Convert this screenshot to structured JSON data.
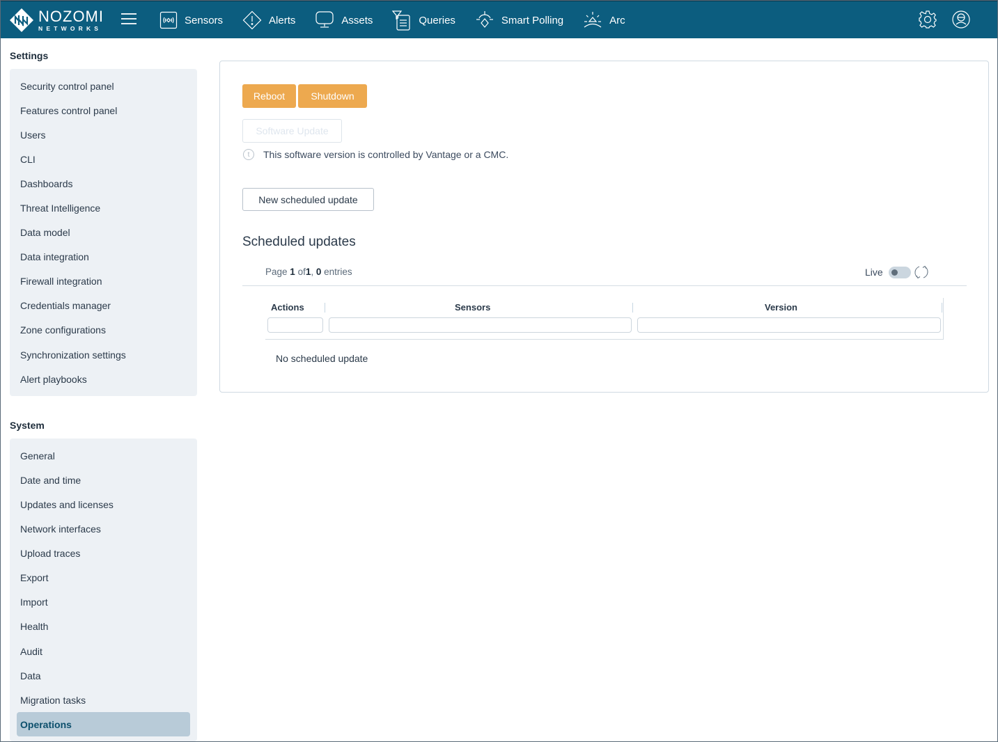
{
  "brand": {
    "name": "NOZOMI",
    "sub": "NETWORKS"
  },
  "nav": {
    "items": [
      {
        "label": "Sensors",
        "icon": "sensors-icon"
      },
      {
        "label": "Alerts",
        "icon": "alert-diamond-icon"
      },
      {
        "label": "Assets",
        "icon": "monitor-icon"
      },
      {
        "label": "Queries",
        "icon": "queries-filter-icon"
      },
      {
        "label": "Smart Polling",
        "icon": "smart-polling-icon"
      },
      {
        "label": "Arc",
        "icon": "arc-sun-icon"
      }
    ],
    "right_icons": [
      "gear-icon",
      "user-avatar-icon"
    ]
  },
  "sidebar": {
    "settings_title": "Settings",
    "settings_items": [
      "Security control panel",
      "Features control panel",
      "Users",
      "CLI",
      "Dashboards",
      "Threat Intelligence",
      "Data model",
      "Data integration",
      "Firewall integration",
      "Credentials manager",
      "Zone configurations",
      "Synchronization settings",
      "Alert playbooks"
    ],
    "system_title": "System",
    "system_items": [
      "General",
      "Date and time",
      "Updates and licenses",
      "Network interfaces",
      "Upload traces",
      "Export",
      "Import",
      "Health",
      "Audit",
      "Data",
      "Migration tasks",
      "Operations"
    ],
    "active_item": "Operations"
  },
  "main": {
    "reboot_label": "Reboot",
    "shutdown_label": "Shutdown",
    "software_update_label": "Software Update",
    "info_text": "This software version is controlled by Vantage or a CMC.",
    "new_scheduled_label": "New scheduled update",
    "scheduled_title": "Scheduled updates",
    "pager": {
      "prefix": "Page",
      "page": "1",
      "of": "of",
      "total_pages": "1",
      "entries_count": "0",
      "entries_label": "entries"
    },
    "live_label": "Live",
    "live_on": false,
    "columns": [
      "Actions",
      "Sensors",
      "Version"
    ],
    "empty_text": "No scheduled update"
  },
  "colors": {
    "topbar": "#0c5d7f",
    "accent_orange": "#eda94f",
    "active_item_bg": "#b8cbd8"
  }
}
